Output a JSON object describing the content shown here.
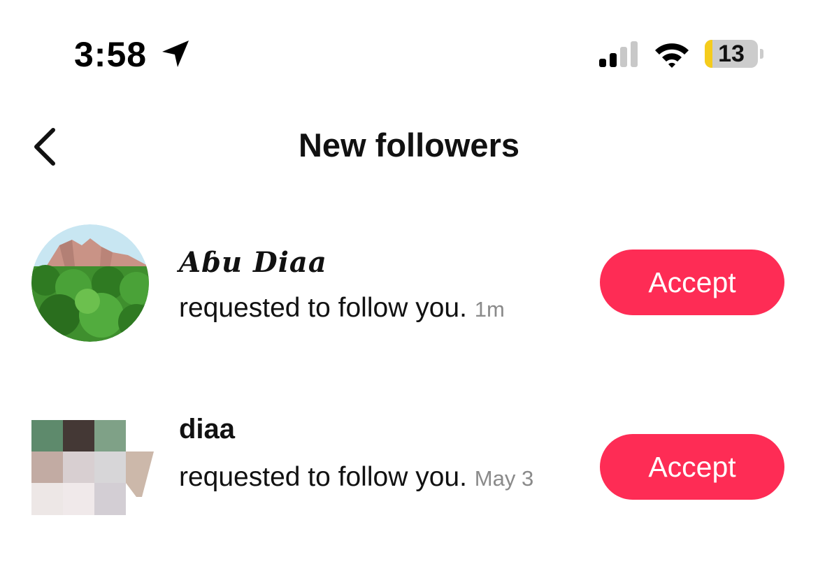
{
  "status_bar": {
    "time": "3:58",
    "battery_level": "13",
    "location_icon": "location-arrow-icon",
    "signal_icon": "cellular-signal-icon",
    "wifi_icon": "wifi-icon"
  },
  "header": {
    "back_icon": "chevron-left-icon",
    "title": "New followers"
  },
  "requests": [
    {
      "username": "Aɓu Diaa",
      "message": "requested to follow you.",
      "time": "1m",
      "action_label": "Accept"
    },
    {
      "username": "diaa",
      "message": "requested to follow you.",
      "time": "May 3",
      "action_label": "Accept"
    }
  ],
  "colors": {
    "accent": "#fe2c55",
    "battery_low": "#f5cc1c",
    "timestamp": "#8a8a8a"
  }
}
